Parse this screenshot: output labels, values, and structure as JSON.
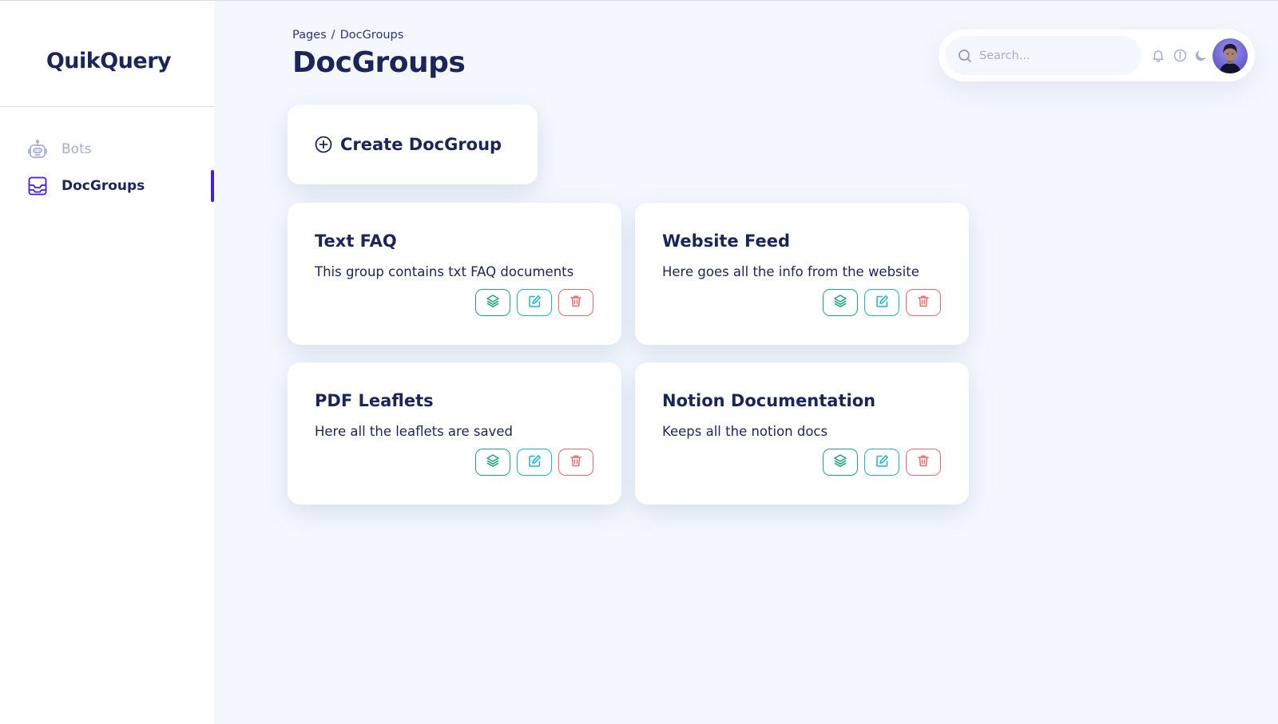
{
  "app": {
    "name": "QuikQuery"
  },
  "sidebar": {
    "items": [
      {
        "label": "Bots",
        "icon": "robot-icon",
        "active": false
      },
      {
        "label": "DocGroups",
        "icon": "inbox-tray-icon",
        "active": true
      }
    ]
  },
  "header": {
    "breadcrumb": {
      "root": "Pages",
      "separator": "/",
      "current": "DocGroups"
    },
    "title": "DocGroups"
  },
  "toolbar": {
    "search": {
      "placeholder": "Search...",
      "value": ""
    },
    "icons": [
      "bell-icon",
      "info-icon",
      "moon-icon"
    ],
    "avatar": "user-avatar"
  },
  "create_button": {
    "label": "Create DocGroup",
    "icon": "plus-circle-icon"
  },
  "groups": [
    {
      "title": "Text FAQ",
      "description": "This group contains txt FAQ documents"
    },
    {
      "title": "Website Feed",
      "description": "Here goes all the info from the website"
    },
    {
      "title": "PDF Leaflets",
      "description": "Here all the leaflets are saved"
    },
    {
      "title": "Notion Documentation",
      "description": "Keeps all the notion docs"
    }
  ],
  "card_actions": {
    "documents": {
      "icon": "layers-icon",
      "color": "#19a57f"
    },
    "edit": {
      "icon": "edit-icon",
      "color": "#1ab3d4"
    },
    "delete": {
      "icon": "trash-icon",
      "color": "#ec6a6f"
    }
  },
  "colors": {
    "accent": "#4318ff",
    "navy": "#1b2559",
    "muted": "#a3aed0",
    "background": "#f4f7fe"
  }
}
